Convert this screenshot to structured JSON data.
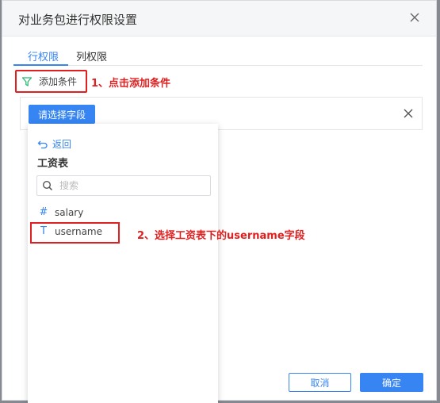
{
  "dialog": {
    "title": "对业务包进行权限设置"
  },
  "tabs": [
    {
      "label": "行权限",
      "active": true
    },
    {
      "label": "列权限",
      "active": false
    }
  ],
  "add_condition": {
    "label": "添加条件",
    "icon": "filter-icon"
  },
  "annotations": {
    "step1": "1、点击添加条件",
    "step2": "2、选择工资表下的username字段"
  },
  "condition": {
    "select_field_label": "请选择字段"
  },
  "dropdown": {
    "back_label": "返回",
    "table_name": "工资表",
    "search_placeholder": "搜索",
    "fields": [
      {
        "type_glyph": "#",
        "name": "salary"
      },
      {
        "type_glyph": "T",
        "name": "username"
      }
    ]
  },
  "footer": {
    "cancel_label": "取消",
    "ok_label": "确定"
  },
  "colors": {
    "accent": "#3685f2",
    "annotation": "#e02020",
    "filter_icon": "#2bb673"
  }
}
